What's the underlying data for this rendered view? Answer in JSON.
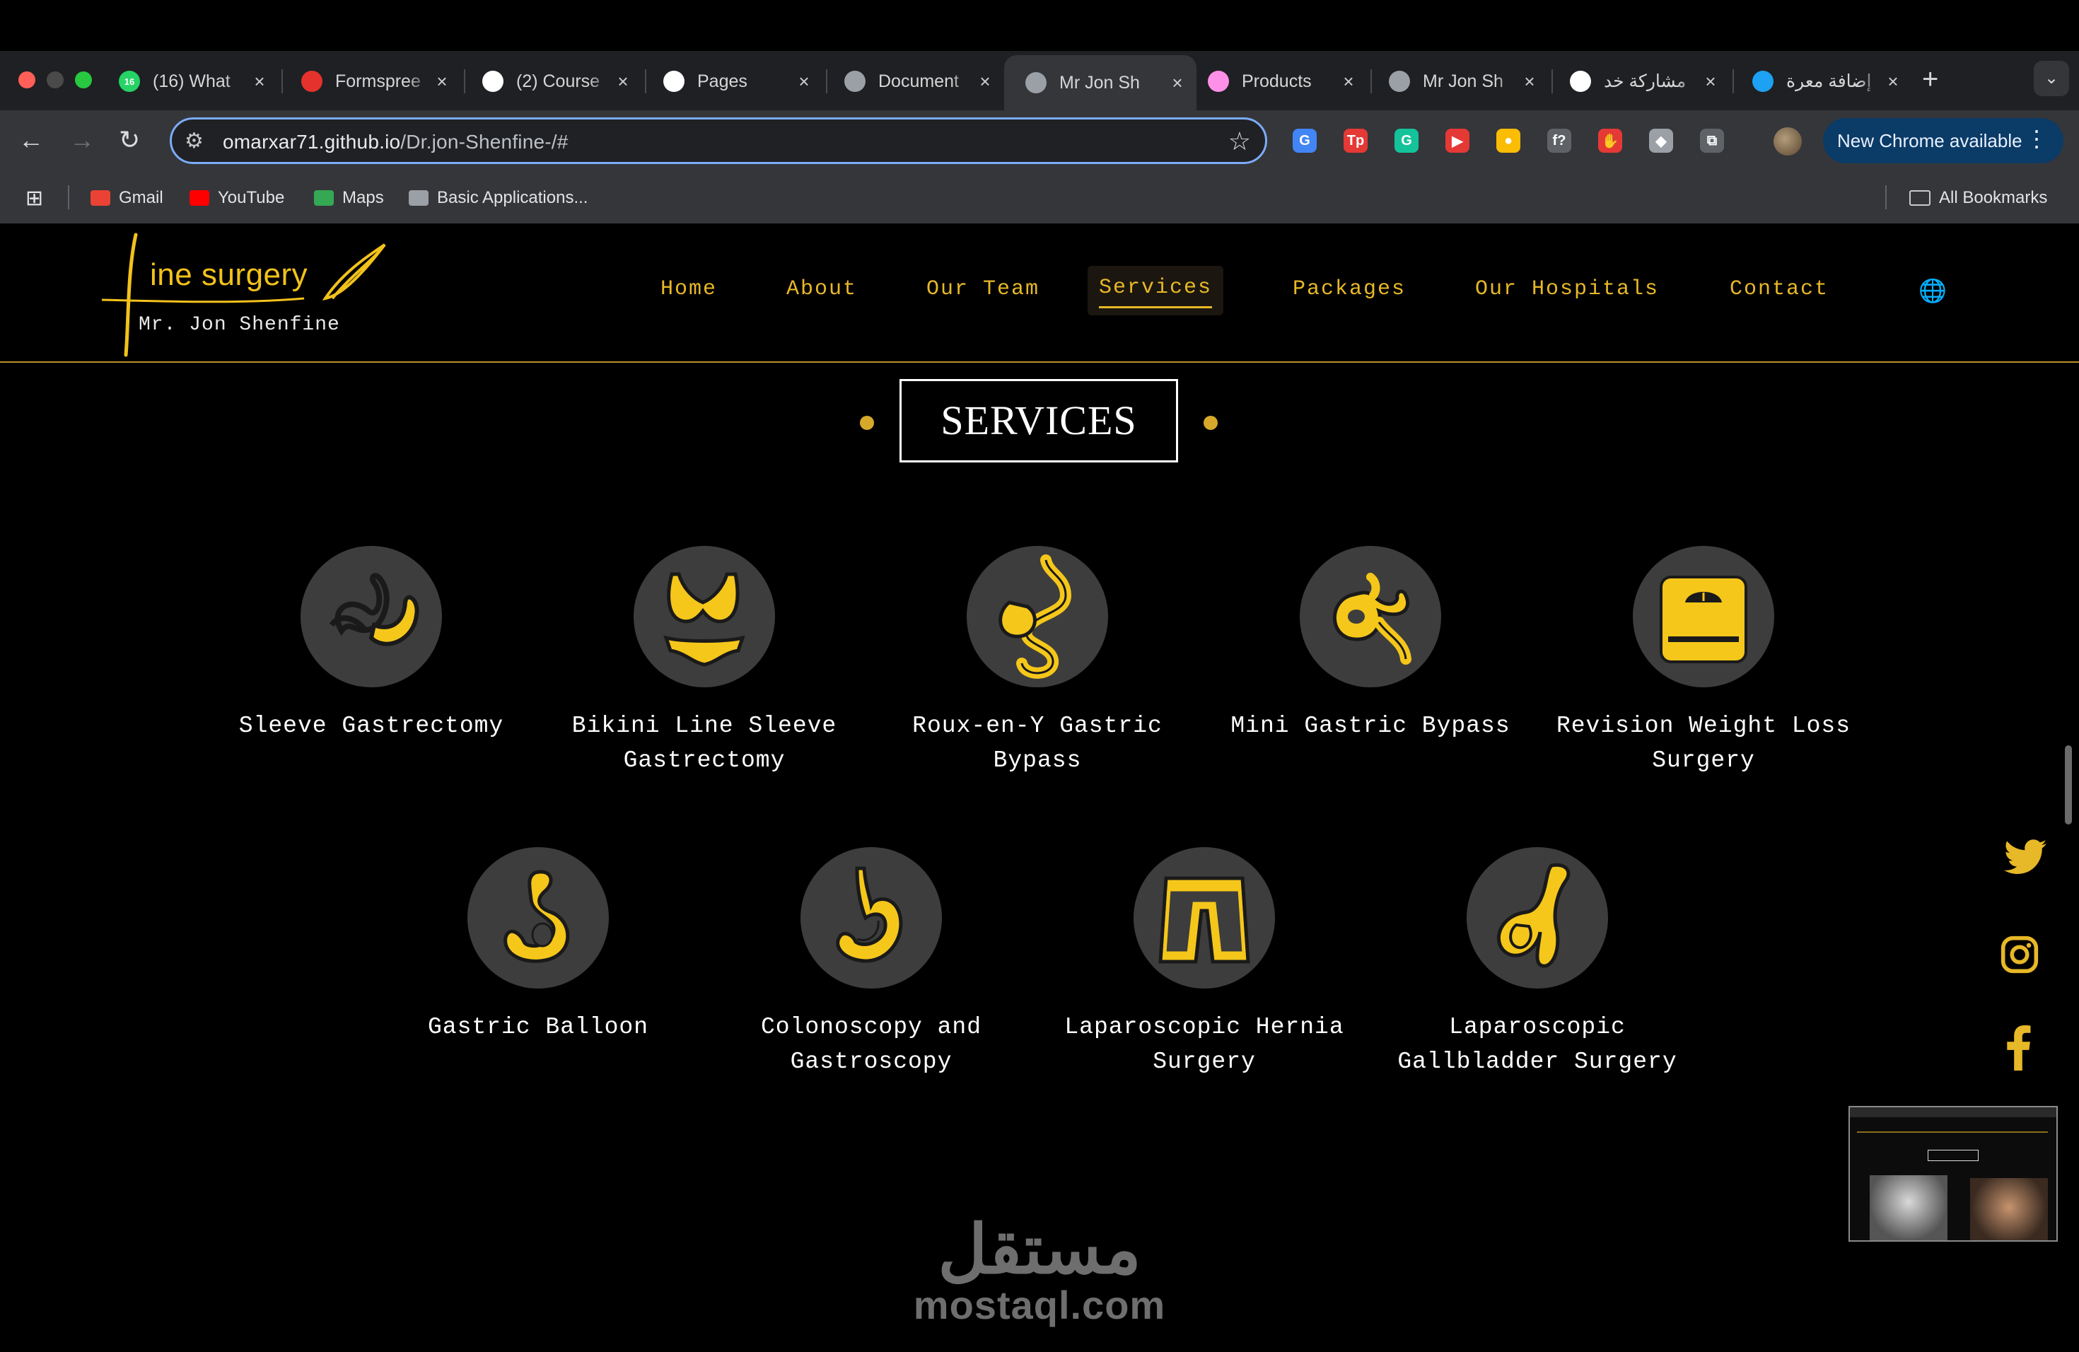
{
  "browser": {
    "tabs": [
      {
        "label": "(16) What",
        "icon": "whatsapp-icon",
        "color": "#25d366",
        "badge": "16"
      },
      {
        "label": "Formspree",
        "icon": "formspree-icon",
        "color": "#e5322d"
      },
      {
        "label": "(2) Course",
        "icon": "notion-icon",
        "color": "#ffffff"
      },
      {
        "label": "Pages",
        "icon": "github-icon",
        "color": "#ffffff"
      },
      {
        "label": "Document",
        "icon": "globe-icon",
        "color": "#9aa0a6"
      },
      {
        "label": "Mr Jon Sh",
        "icon": "globe-icon",
        "color": "#9aa0a6",
        "active": true
      },
      {
        "label": "Products",
        "icon": "gumroad-icon",
        "color": "#ff90e8"
      },
      {
        "label": "Mr Jon Sh",
        "icon": "globe-icon",
        "color": "#9aa0a6"
      },
      {
        "label": "مشاركة خد",
        "icon": "openai-icon",
        "color": "#ffffff"
      },
      {
        "label": "إضافة معرة",
        "icon": "circle-icon",
        "color": "#1da1f2"
      }
    ],
    "new_tab": "+",
    "url_host": "omarxar71.github.io",
    "url_path": "/Dr.jon-Shenfine-/#",
    "new_chrome_label": "New Chrome available",
    "extensions": [
      {
        "icon": "translate-icon",
        "text": "G",
        "color": "#4285f4"
      },
      {
        "icon": "tp-icon",
        "text": "Tp",
        "color": "#e53935"
      },
      {
        "icon": "grammarly-icon",
        "text": "G",
        "color": "#15c39a"
      },
      {
        "icon": "youtube-ext-icon",
        "text": "▶",
        "color": "#e53935"
      },
      {
        "icon": "keep-icon",
        "text": "●",
        "color": "#fbbc04"
      },
      {
        "icon": "fx-icon",
        "text": "f?",
        "color": "#5f6368"
      },
      {
        "icon": "adblock-icon",
        "text": "✋",
        "color": "#e53935"
      },
      {
        "icon": "shield-icon",
        "text": "◆",
        "color": "#9aa0a6"
      },
      {
        "icon": "puzzle-icon",
        "text": "⧉",
        "color": "#5f6368"
      }
    ],
    "bookmarks": [
      {
        "label": "Gmail",
        "icon": "gmail-icon",
        "color": "#ea4335"
      },
      {
        "label": "YouTube",
        "icon": "youtube-icon",
        "color": "#ff0000"
      },
      {
        "label": "Maps",
        "icon": "maps-icon",
        "color": "#34a853"
      },
      {
        "label": "Basic Applications...",
        "icon": "app-icon",
        "color": "#9aa0a6"
      }
    ],
    "all_bookmarks": "All Bookmarks"
  },
  "site": {
    "logo_main": "ine surgery",
    "logo_sub": "Mr. Jon Shenfine",
    "nav": [
      "Home",
      "About",
      "Our Team",
      "Services",
      "Packages",
      "Our Hospitals",
      "Contact"
    ],
    "active_nav": "Services",
    "accent": "#e7b827",
    "section_title": "SERVICES",
    "services": [
      {
        "label": "Sleeve Gastrectomy",
        "icon": "sleeve-gastrectomy-icon"
      },
      {
        "label": "Bikini Line Sleeve Gastrectomy",
        "icon": "bikini-icon"
      },
      {
        "label": "Roux-en-Y Gastric Bypass",
        "icon": "roux-en-y-icon"
      },
      {
        "label": "Mini Gastric Bypass",
        "icon": "mini-bypass-icon"
      },
      {
        "label": "Revision Weight Loss Surgery",
        "icon": "scale-icon"
      },
      {
        "label": "Gastric Balloon",
        "icon": "gastric-balloon-icon"
      },
      {
        "label": "Colonoscopy and Gastroscopy",
        "icon": "stomach-icon"
      },
      {
        "label": "Laparoscopic Hernia Surgery",
        "icon": "shorts-icon"
      },
      {
        "label": "Laparoscopic Gallbladder Surgery",
        "icon": "gallbladder-icon"
      }
    ],
    "social": [
      "twitter-icon",
      "instagram-icon",
      "facebook-icon"
    ]
  },
  "watermark": {
    "arabic": "مستقل",
    "latin": "mostaql.com"
  }
}
